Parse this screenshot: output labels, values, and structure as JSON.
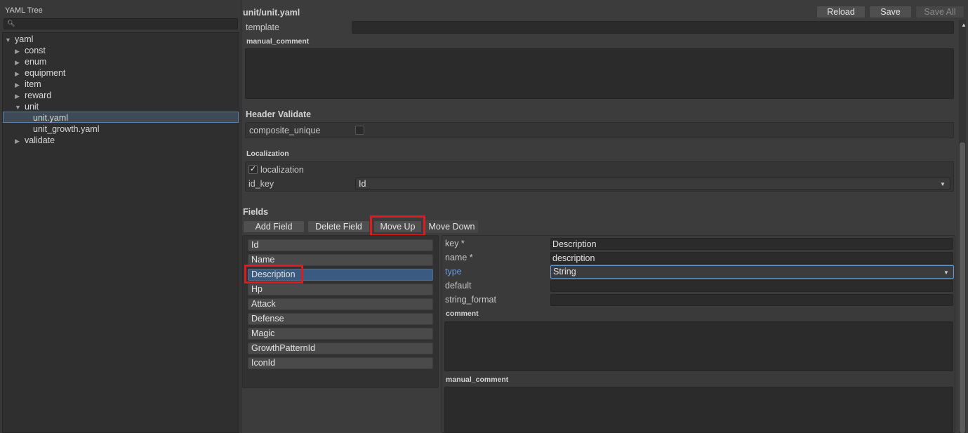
{
  "tree": {
    "title": "YAML Tree",
    "search_placeholder": "",
    "nodes": [
      {
        "label": "yaml",
        "arrow": "▼"
      },
      {
        "label": "const",
        "arrow": "▶"
      },
      {
        "label": "enum",
        "arrow": "▶"
      },
      {
        "label": "equipment",
        "arrow": "▶"
      },
      {
        "label": "item",
        "arrow": "▶"
      },
      {
        "label": "reward",
        "arrow": "▶"
      },
      {
        "label": "unit",
        "arrow": "▼"
      },
      {
        "label": "unit.yaml",
        "arrow": ""
      },
      {
        "label": "unit_growth.yaml",
        "arrow": ""
      },
      {
        "label": "validate",
        "arrow": "▶"
      }
    ]
  },
  "editor": {
    "file_title": "unit/unit.yaml",
    "reload_label": "Reload",
    "save_label": "Save",
    "save_all_label": "Save All",
    "template_label": "template",
    "template_value": "",
    "manual_comment_label": "manual_comment",
    "header_validate_label": "Header Validate",
    "composite_unique_label": "composite_unique",
    "composite_unique_checked": false,
    "localization_section": "Localization",
    "localization_label": "localization",
    "localization_checked": true,
    "id_key_label": "id_key",
    "id_key_value": "Id",
    "fields_label": "Fields",
    "add_field_label": "Add Field",
    "delete_field_label": "Delete Field",
    "move_up_label": "Move Up",
    "move_down_label": "Move Down",
    "field_list": [
      "Id",
      "Name",
      "Description",
      "Hp",
      "Attack",
      "Defense",
      "Magic",
      "GrowthPatternId",
      "IconId"
    ],
    "selected_field": "Description",
    "detail": {
      "key_label": "key *",
      "key_value": "Description",
      "name_label": "name *",
      "name_value": "description",
      "type_label": "type",
      "type_value": "String",
      "default_label": "default",
      "default_value": "",
      "string_format_label": "string_format",
      "string_format_value": "",
      "comment_label": "comment",
      "manual_comment_label": "manual_comment"
    }
  },
  "colors": {
    "highlight_box": "#e01b1b",
    "selection_blue": "#3b5a80",
    "type_label_blue": "#6d9ad6"
  }
}
